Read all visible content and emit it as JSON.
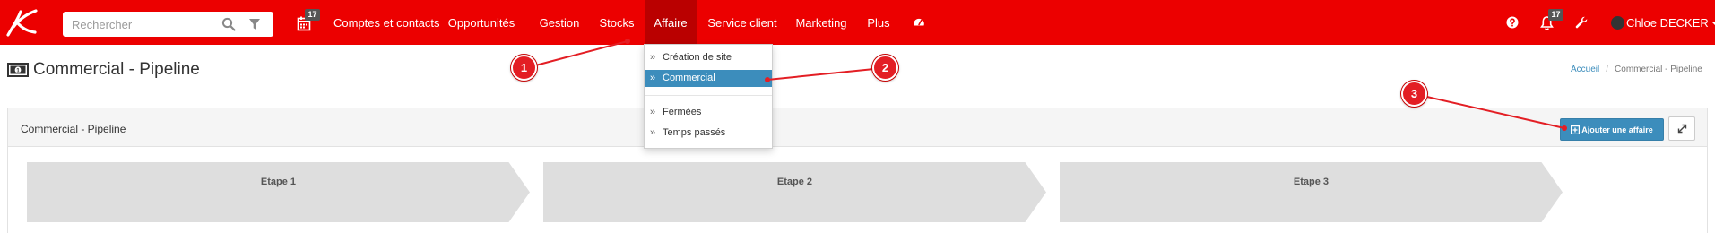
{
  "navbar": {
    "search_placeholder": "Rechercher",
    "calendar_badge": "17",
    "items": [
      "Comptes et contacts",
      "Opportunités",
      "Gestion",
      "Stocks",
      "Affaire",
      "Service client",
      "Marketing",
      "Plus"
    ],
    "active_item": "Affaire",
    "notifications_badge": "17",
    "user_name": "Chloe DECKER"
  },
  "dropdown": {
    "items": [
      "Création de site",
      "Commercial",
      "Fermées",
      "Temps passés"
    ],
    "active_item": "Commercial"
  },
  "page": {
    "title": "Commercial - Pipeline",
    "breadcrumb": [
      "Accueil",
      "Commercial - Pipeline"
    ]
  },
  "box": {
    "title": "Commercial - Pipeline",
    "add_button": "Ajouter une affaire"
  },
  "pipeline": {
    "stages": [
      "Etape 1",
      "Etape 2",
      "Etape 3"
    ]
  },
  "annotations": [
    "1",
    "2",
    "3"
  ],
  "colors": {
    "navbar": "#ec0000",
    "navbar_active": "#ba0000",
    "primary": "#3c8dbc",
    "callout": "#e31e24",
    "stage": "#dedede"
  }
}
